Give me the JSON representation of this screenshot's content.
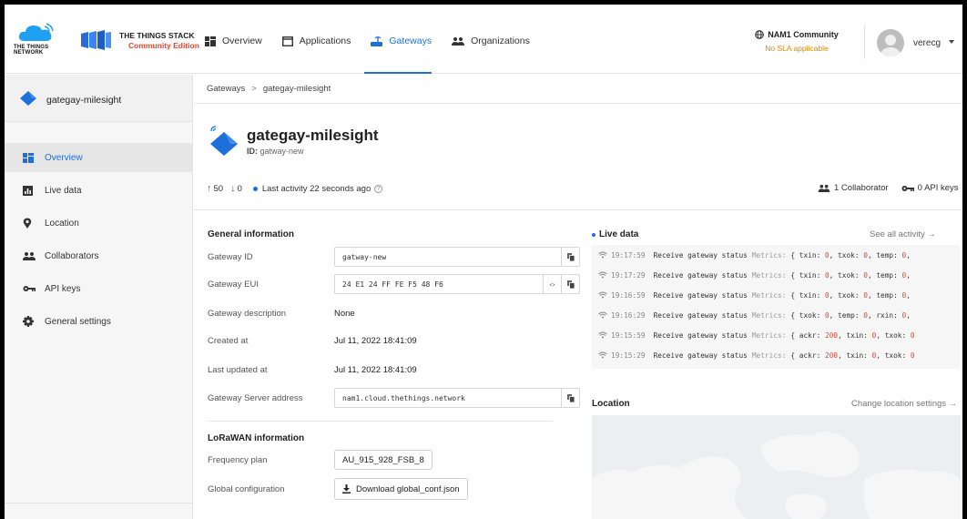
{
  "header": {
    "ttn_logo_text": [
      "THE THINGS",
      "NETWORK"
    ],
    "stack_title": "THE THINGS STACK",
    "stack_subtitle": "Community Edition",
    "nav": [
      {
        "label": "Overview",
        "icon": "grid-icon",
        "active": false
      },
      {
        "label": "Applications",
        "icon": "window-icon",
        "active": false
      },
      {
        "label": "Gateways",
        "icon": "gateway-icon",
        "active": true
      },
      {
        "label": "Organizations",
        "icon": "people-icon",
        "active": false
      }
    ],
    "cluster_name": "NAM1 Community",
    "cluster_sla": "No SLA applicable",
    "username": "verecg"
  },
  "sidebar": {
    "gateway_name": "gategay-milesight",
    "items": [
      {
        "label": "Overview",
        "icon": "grid-icon",
        "active": true
      },
      {
        "label": "Live data",
        "icon": "bar-chart-icon",
        "active": false
      },
      {
        "label": "Location",
        "icon": "map-pin-icon",
        "active": false
      },
      {
        "label": "Collaborators",
        "icon": "people-icon",
        "active": false
      },
      {
        "label": "API keys",
        "icon": "key-icon",
        "active": false
      },
      {
        "label": "General settings",
        "icon": "gear-icon",
        "active": false
      }
    ]
  },
  "breadcrumb": {
    "root": "Gateways",
    "separator": ">",
    "current": "gategay-milesight"
  },
  "gateway": {
    "title": "gategay-milesight",
    "id_label": "ID:",
    "id_value": "gatway-new",
    "up_count": "50",
    "down_count": "0",
    "last_activity": "Last activity 22 seconds ago",
    "collaborators": "1 Collaborator",
    "api_keys": "0 API keys"
  },
  "general": {
    "title": "General information",
    "gateway_id_label": "Gateway ID",
    "gateway_id": "gatway-new",
    "gateway_eui_label": "Gateway EUI",
    "gateway_eui": "24 E1 24 FF FE F5 48 F6",
    "description_label": "Gateway description",
    "description": "None",
    "created_label": "Created at",
    "created": "Jul 11, 2022 18:41:09",
    "updated_label": "Last updated at",
    "updated": "Jul 11, 2022 18:41:09",
    "server_label": "Gateway Server address",
    "server": "nam1.cloud.thethings.network"
  },
  "lorawan": {
    "title": "LoRaWAN information",
    "freq_label": "Frequency plan",
    "freq": "AU_915_928_FSB_8",
    "global_label": "Global configuration",
    "download_button": "Download global_conf.json"
  },
  "live": {
    "title": "Live data",
    "see_all": "See all activity →",
    "rows": [
      {
        "time": "19:17:59",
        "message": "Receive gateway status",
        "metrics": "Metrics:",
        "fields": "{ txin: 0, txok: 0, temp: 0,"
      },
      {
        "time": "19:17:29",
        "message": "Receive gateway status",
        "metrics": "Metrics:",
        "fields": "{ txin: 0, txok: 0, temp: 0,"
      },
      {
        "time": "19:16:59",
        "message": "Receive gateway status",
        "metrics": "Metrics:",
        "fields": "{ txin: 0, txok: 0, temp: 0,"
      },
      {
        "time": "19:16:29",
        "message": "Receive gateway status",
        "metrics": "Metrics:",
        "fields": "{ txok: 0, temp: 0, rxin: 0,"
      },
      {
        "time": "19:15:59",
        "message": "Receive gateway status",
        "metrics": "Metrics:",
        "fields": "{ ackr: 200, txin: 0, txok: 0"
      },
      {
        "time": "19:15:29",
        "message": "Receive gateway status",
        "metrics": "Metrics:",
        "fields": "{ ackr: 200, txin: 0, txok: 0"
      }
    ]
  },
  "location": {
    "title": "Location",
    "change": "Change location settings →"
  },
  "colors": {
    "accent": "#1e6fd9",
    "brand_red": "#e8462f",
    "sla_orange": "#d2880f"
  }
}
